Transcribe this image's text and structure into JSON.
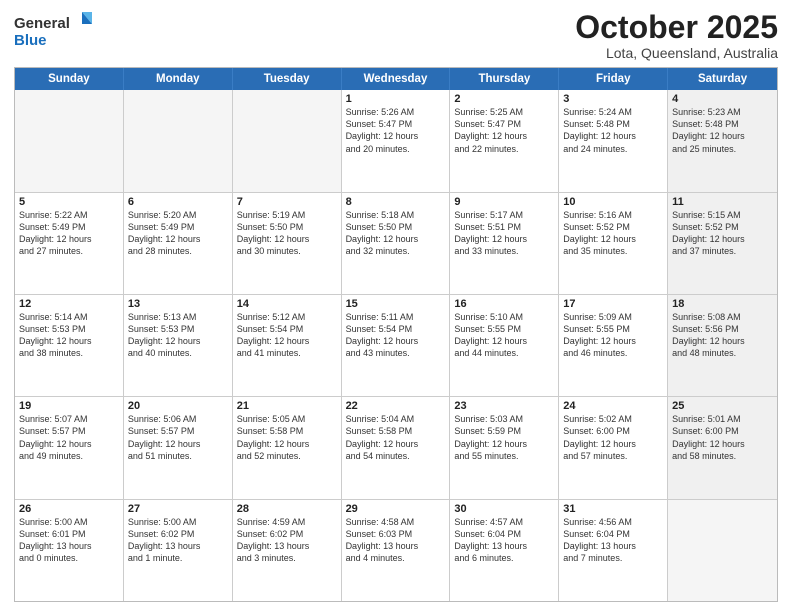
{
  "header": {
    "logo_general": "General",
    "logo_blue": "Blue",
    "month_title": "October 2025",
    "location": "Lota, Queensland, Australia"
  },
  "weekdays": [
    "Sunday",
    "Monday",
    "Tuesday",
    "Wednesday",
    "Thursday",
    "Friday",
    "Saturday"
  ],
  "rows": [
    [
      {
        "day": "",
        "detail": "",
        "empty": true
      },
      {
        "day": "",
        "detail": "",
        "empty": true
      },
      {
        "day": "",
        "detail": "",
        "empty": true
      },
      {
        "day": "1",
        "detail": "Sunrise: 5:26 AM\nSunset: 5:47 PM\nDaylight: 12 hours\nand 20 minutes.",
        "empty": false
      },
      {
        "day": "2",
        "detail": "Sunrise: 5:25 AM\nSunset: 5:47 PM\nDaylight: 12 hours\nand 22 minutes.",
        "empty": false
      },
      {
        "day": "3",
        "detail": "Sunrise: 5:24 AM\nSunset: 5:48 PM\nDaylight: 12 hours\nand 24 minutes.",
        "empty": false
      },
      {
        "day": "4",
        "detail": "Sunrise: 5:23 AM\nSunset: 5:48 PM\nDaylight: 12 hours\nand 25 minutes.",
        "empty": false,
        "shaded": true
      }
    ],
    [
      {
        "day": "5",
        "detail": "Sunrise: 5:22 AM\nSunset: 5:49 PM\nDaylight: 12 hours\nand 27 minutes.",
        "empty": false
      },
      {
        "day": "6",
        "detail": "Sunrise: 5:20 AM\nSunset: 5:49 PM\nDaylight: 12 hours\nand 28 minutes.",
        "empty": false
      },
      {
        "day": "7",
        "detail": "Sunrise: 5:19 AM\nSunset: 5:50 PM\nDaylight: 12 hours\nand 30 minutes.",
        "empty": false
      },
      {
        "day": "8",
        "detail": "Sunrise: 5:18 AM\nSunset: 5:50 PM\nDaylight: 12 hours\nand 32 minutes.",
        "empty": false
      },
      {
        "day": "9",
        "detail": "Sunrise: 5:17 AM\nSunset: 5:51 PM\nDaylight: 12 hours\nand 33 minutes.",
        "empty": false
      },
      {
        "day": "10",
        "detail": "Sunrise: 5:16 AM\nSunset: 5:52 PM\nDaylight: 12 hours\nand 35 minutes.",
        "empty": false
      },
      {
        "day": "11",
        "detail": "Sunrise: 5:15 AM\nSunset: 5:52 PM\nDaylight: 12 hours\nand 37 minutes.",
        "empty": false,
        "shaded": true
      }
    ],
    [
      {
        "day": "12",
        "detail": "Sunrise: 5:14 AM\nSunset: 5:53 PM\nDaylight: 12 hours\nand 38 minutes.",
        "empty": false
      },
      {
        "day": "13",
        "detail": "Sunrise: 5:13 AM\nSunset: 5:53 PM\nDaylight: 12 hours\nand 40 minutes.",
        "empty": false
      },
      {
        "day": "14",
        "detail": "Sunrise: 5:12 AM\nSunset: 5:54 PM\nDaylight: 12 hours\nand 41 minutes.",
        "empty": false
      },
      {
        "day": "15",
        "detail": "Sunrise: 5:11 AM\nSunset: 5:54 PM\nDaylight: 12 hours\nand 43 minutes.",
        "empty": false
      },
      {
        "day": "16",
        "detail": "Sunrise: 5:10 AM\nSunset: 5:55 PM\nDaylight: 12 hours\nand 44 minutes.",
        "empty": false
      },
      {
        "day": "17",
        "detail": "Sunrise: 5:09 AM\nSunset: 5:55 PM\nDaylight: 12 hours\nand 46 minutes.",
        "empty": false
      },
      {
        "day": "18",
        "detail": "Sunrise: 5:08 AM\nSunset: 5:56 PM\nDaylight: 12 hours\nand 48 minutes.",
        "empty": false,
        "shaded": true
      }
    ],
    [
      {
        "day": "19",
        "detail": "Sunrise: 5:07 AM\nSunset: 5:57 PM\nDaylight: 12 hours\nand 49 minutes.",
        "empty": false
      },
      {
        "day": "20",
        "detail": "Sunrise: 5:06 AM\nSunset: 5:57 PM\nDaylight: 12 hours\nand 51 minutes.",
        "empty": false
      },
      {
        "day": "21",
        "detail": "Sunrise: 5:05 AM\nSunset: 5:58 PM\nDaylight: 12 hours\nand 52 minutes.",
        "empty": false
      },
      {
        "day": "22",
        "detail": "Sunrise: 5:04 AM\nSunset: 5:58 PM\nDaylight: 12 hours\nand 54 minutes.",
        "empty": false
      },
      {
        "day": "23",
        "detail": "Sunrise: 5:03 AM\nSunset: 5:59 PM\nDaylight: 12 hours\nand 55 minutes.",
        "empty": false
      },
      {
        "day": "24",
        "detail": "Sunrise: 5:02 AM\nSunset: 6:00 PM\nDaylight: 12 hours\nand 57 minutes.",
        "empty": false
      },
      {
        "day": "25",
        "detail": "Sunrise: 5:01 AM\nSunset: 6:00 PM\nDaylight: 12 hours\nand 58 minutes.",
        "empty": false,
        "shaded": true
      }
    ],
    [
      {
        "day": "26",
        "detail": "Sunrise: 5:00 AM\nSunset: 6:01 PM\nDaylight: 13 hours\nand 0 minutes.",
        "empty": false
      },
      {
        "day": "27",
        "detail": "Sunrise: 5:00 AM\nSunset: 6:02 PM\nDaylight: 13 hours\nand 1 minute.",
        "empty": false
      },
      {
        "day": "28",
        "detail": "Sunrise: 4:59 AM\nSunset: 6:02 PM\nDaylight: 13 hours\nand 3 minutes.",
        "empty": false
      },
      {
        "day": "29",
        "detail": "Sunrise: 4:58 AM\nSunset: 6:03 PM\nDaylight: 13 hours\nand 4 minutes.",
        "empty": false
      },
      {
        "day": "30",
        "detail": "Sunrise: 4:57 AM\nSunset: 6:04 PM\nDaylight: 13 hours\nand 6 minutes.",
        "empty": false
      },
      {
        "day": "31",
        "detail": "Sunrise: 4:56 AM\nSunset: 6:04 PM\nDaylight: 13 hours\nand 7 minutes.",
        "empty": false
      },
      {
        "day": "",
        "detail": "",
        "empty": true,
        "shaded": true
      }
    ]
  ]
}
